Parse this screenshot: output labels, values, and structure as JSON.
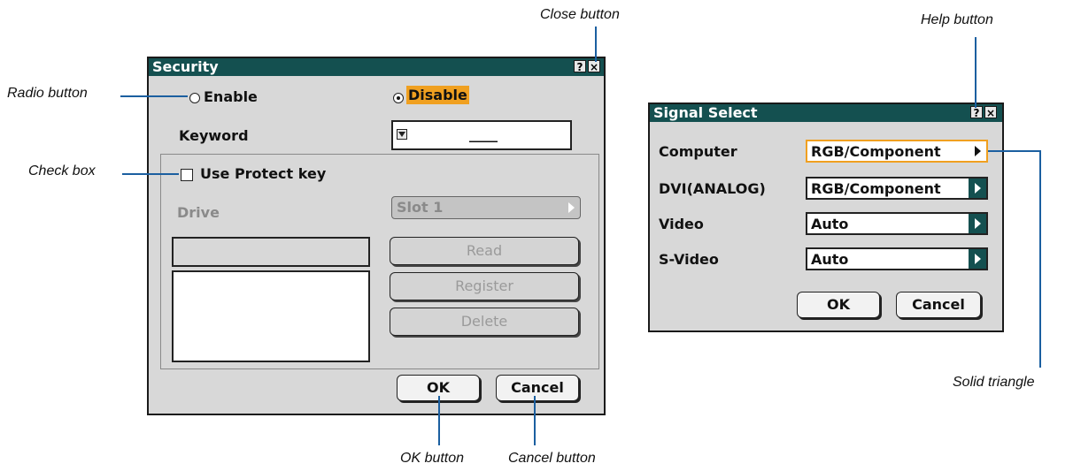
{
  "security": {
    "title": "Security",
    "help_glyph": "?",
    "close_glyph": "×",
    "enable_label": "Enable",
    "disable_label": "Disable",
    "keyword_label": "Keyword",
    "keyword_value": "____",
    "protect_label": "Use Protect key",
    "drive_label": "Drive",
    "drive_value": "Slot 1",
    "read_label": "Read",
    "register_label": "Register",
    "delete_label": "Delete",
    "ok_label": "OK",
    "cancel_label": "Cancel",
    "selected_radio": "Disable"
  },
  "signal_select": {
    "title": "Signal Select",
    "help_glyph": "?",
    "close_glyph": "×",
    "rows": [
      {
        "label": "Computer",
        "value": "RGB/Component",
        "highlighted": true
      },
      {
        "label": "DVI(ANALOG)",
        "value": "RGB/Component",
        "highlighted": false
      },
      {
        "label": "Video",
        "value": "Auto",
        "highlighted": false
      },
      {
        "label": "S-Video",
        "value": "Auto",
        "highlighted": false
      }
    ],
    "ok_label": "OK",
    "cancel_label": "Cancel"
  },
  "callouts": {
    "close_button": "Close button",
    "help_button": "Help button",
    "radio_button": "Radio button",
    "check_box": "Check box",
    "ok_button": "OK button",
    "cancel_button": "Cancel button",
    "solid_triangle": "Solid triangle"
  },
  "colors": {
    "titlebar": "#145050",
    "highlight": "#f0a020",
    "callout_line": "#1b5fa0"
  }
}
